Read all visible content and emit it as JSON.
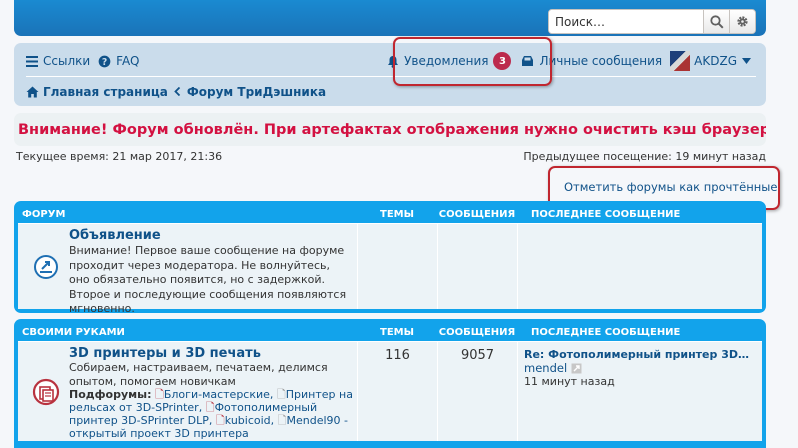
{
  "search": {
    "placeholder": "Поиск…"
  },
  "nav": {
    "links_label": "Ссылки",
    "faq_label": "FAQ",
    "notifications_label": "Уведомления",
    "notifications_count": "3",
    "messages_label": "Личные сообщения",
    "username": "AKDZG",
    "breadcrumb_home": "Главная страница",
    "breadcrumb_forum": "Форум ТриДэшника"
  },
  "notice": {
    "text": "Внимание! Форум обновлён. При артефактах отображения нужно очистить кэш браузера (ссылка)."
  },
  "time": {
    "current": "Текущее время: 21 мар 2017, 21:36",
    "last_visit": "Предыдущее посещение: 19 минут назад"
  },
  "mark_read": "Отметить форумы как прочтённые",
  "blocks": [
    {
      "header": {
        "forum": "Форум",
        "topics": "Темы",
        "posts": "Сообщения",
        "last": "Последнее сообщение"
      },
      "rows": [
        {
          "title": "Объявление",
          "desc": "Внимание! Первое ваше сообщение на форуме проходит через модератора. Не волнуйтесь, оно обязательно появится, но с задержкой. Второе и последующие сообщения появляются мгновенно."
        }
      ]
    },
    {
      "header": {
        "forum": "Своими руками",
        "topics": "Темы",
        "posts": "Сообщения",
        "last": "Последнее сообщение"
      },
      "rows": [
        {
          "title": "3D принтеры и 3D печать",
          "desc": "Собираем, настраиваем, печатаем, делимся опытом, помогаем новичкам",
          "subforums_label": "Подфорумы:",
          "subforums": [
            "Блоги-мастерские",
            "Принтер на рельсах от 3D-SPrinter",
            "Фотополимерный принтер 3D-SPrinter DLP",
            "kubicoid",
            "Mendel90 - открытый проект 3D принтера"
          ],
          "topics": "116",
          "posts": "9057",
          "last_title": "Re: Фотополимерный принтер 3D…",
          "last_author": "mendel",
          "last_time": "11 минут назад"
        }
      ]
    }
  ]
}
